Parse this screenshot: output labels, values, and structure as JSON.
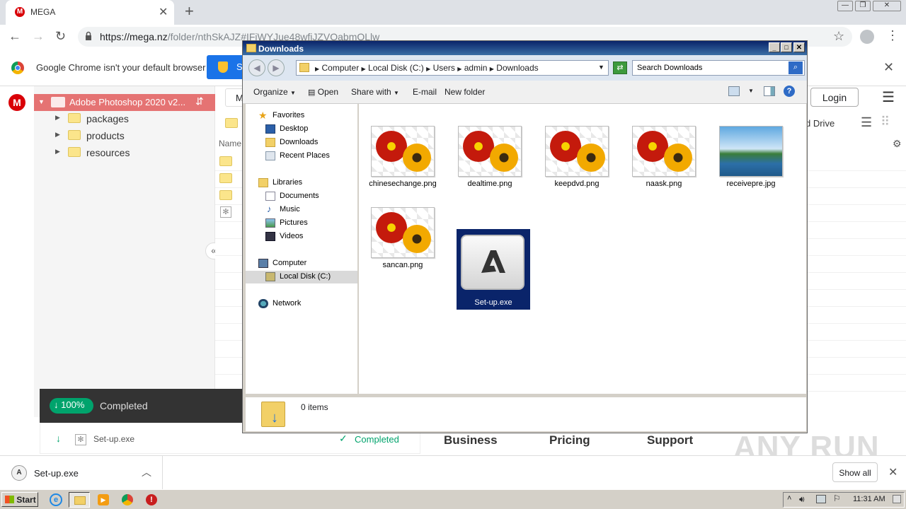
{
  "browser": {
    "tab_title": "MEGA",
    "url_domain": "https://mega.nz",
    "url_path": "/folder/nthSkAJZ#IFjWYJue48wfjJZVQabmQLlw",
    "infobar_text": "Google Chrome isn't your default browser",
    "infobar_button": "S"
  },
  "mega": {
    "root_folder": "Adobe Photoshop 2020 v2...",
    "tree": [
      "packages",
      "products",
      "resources"
    ],
    "column_name": "Name",
    "column_cut": "M",
    "login": "Login",
    "cloud_drive": "d Drive",
    "transfer_percent": "100%",
    "transfer_status": "Completed",
    "transfer_file": "Set-up.exe",
    "transfer_file_status": "Completed",
    "footer_links": [
      "Business",
      "Pricing",
      "Support"
    ]
  },
  "explorer": {
    "title": "Downloads",
    "breadcrumb": [
      "Computer",
      "Local Disk (C:)",
      "Users",
      "admin",
      "Downloads"
    ],
    "search_placeholder": "Search Downloads",
    "commands": {
      "organize": "Organize",
      "open": "Open",
      "share": "Share with",
      "email": "E-mail",
      "new_folder": "New folder"
    },
    "nav": {
      "favorites": "Favorites",
      "desktop": "Desktop",
      "downloads": "Downloads",
      "recent": "Recent Places",
      "libraries": "Libraries",
      "documents": "Documents",
      "music": "Music",
      "pictures": "Pictures",
      "videos": "Videos",
      "computer": "Computer",
      "local_disk": "Local Disk (C:)",
      "network": "Network"
    },
    "files": [
      "chinesechange.png",
      "dealtime.png",
      "keepdvd.png",
      "naask.png",
      "receivepre.jpg",
      "sancan.png",
      "Set-up.exe"
    ],
    "status": "0 items"
  },
  "shelf": {
    "file": "Set-up.exe",
    "show_all": "Show all"
  },
  "taskbar": {
    "start": "Start",
    "time": "11:31 AM"
  },
  "watermark": "ANY RUN"
}
